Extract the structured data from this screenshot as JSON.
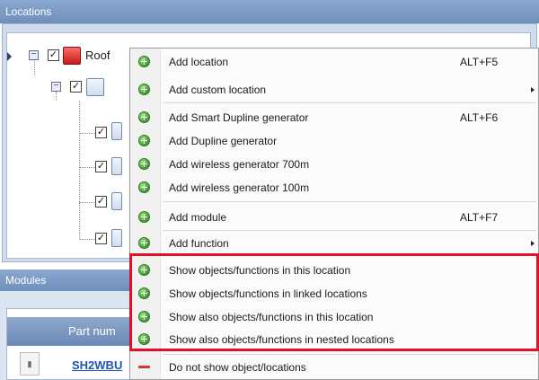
{
  "locations_panel": {
    "title": "Locations",
    "root_label": "Roof"
  },
  "modules_panel": {
    "title": "Modules",
    "column_header": "Part num",
    "row_part": "SH2WBU"
  },
  "context_menu": {
    "items": [
      {
        "label": "Add location",
        "shortcut": "ALT+F5",
        "icon": "add-icon",
        "submenu": false
      },
      {
        "label": "Add custom location",
        "shortcut": "",
        "icon": "add-icon",
        "submenu": true
      },
      {
        "label": "Add Smart Dupline generator",
        "shortcut": "ALT+F6",
        "icon": "add-icon",
        "submenu": false
      },
      {
        "label": "Add Dupline generator",
        "shortcut": "",
        "icon": "add-icon",
        "submenu": false
      },
      {
        "label": "Add wireless generator 700m",
        "shortcut": "",
        "icon": "add-icon",
        "submenu": false
      },
      {
        "label": "Add wireless generator 100m",
        "shortcut": "",
        "icon": "add-icon",
        "submenu": false
      },
      {
        "label": "Add module",
        "shortcut": "ALT+F7",
        "icon": "add-icon",
        "submenu": false
      },
      {
        "label": "Add function",
        "shortcut": "",
        "icon": "add-icon",
        "submenu": true
      },
      {
        "label": "Show objects/functions in this location",
        "shortcut": "",
        "icon": "add-icon",
        "submenu": false
      },
      {
        "label": "Show objects/functions in linked locations",
        "shortcut": "",
        "icon": "add-icon",
        "submenu": false
      },
      {
        "label": "Show also objects/functions in this location",
        "shortcut": "",
        "icon": "add-icon",
        "submenu": false
      },
      {
        "label": "Show also objects/functions in nested locations",
        "shortcut": "",
        "icon": "add-icon",
        "submenu": false
      },
      {
        "label": "Do not show object/locations",
        "shortcut": "",
        "icon": "remove-icon",
        "submenu": false
      }
    ]
  },
  "colors": {
    "header_blue": "#7a98c4",
    "highlight_red": "#e0102b",
    "add_icon_green": "#3c9a2b",
    "remove_icon_red": "#d33333",
    "link_blue": "#1d56b0"
  }
}
